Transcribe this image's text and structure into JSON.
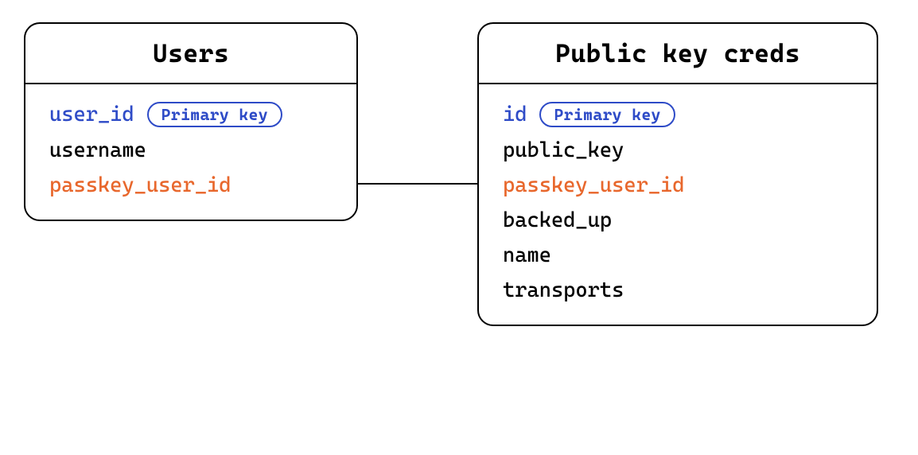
{
  "entities": {
    "users": {
      "title": "Users",
      "fields": [
        {
          "name": "user_id",
          "role": "pk",
          "badge": "Primary key"
        },
        {
          "name": "username",
          "role": "normal"
        },
        {
          "name": "passkey_user_id",
          "role": "fk"
        }
      ]
    },
    "creds": {
      "title": "Public key creds",
      "fields": [
        {
          "name": "id",
          "role": "pk",
          "badge": "Primary key"
        },
        {
          "name": "public_key",
          "role": "normal"
        },
        {
          "name": "passkey_user_id",
          "role": "fk"
        },
        {
          "name": "backed_up",
          "role": "normal"
        },
        {
          "name": "name",
          "role": "normal"
        },
        {
          "name": "transports",
          "role": "normal"
        }
      ]
    }
  },
  "relationship": {
    "from": "users.passkey_user_id",
    "to": "creds.passkey_user_id"
  }
}
